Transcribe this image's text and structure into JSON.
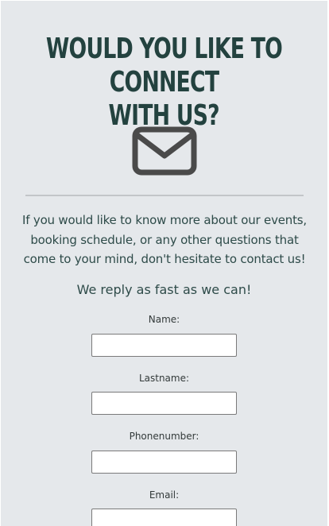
{
  "heading": {
    "line1": "WOULD YOU LIKE TO CONNECT",
    "line2": "WITH US?"
  },
  "icon": "envelope-icon",
  "intro_text": "If you would like to know more about our events, booking schedule, or any other questions that come to your mind, don't hesitate to contact us!",
  "reply_text": "We reply as fast as we can!",
  "form": {
    "fields": [
      {
        "label": "Name:",
        "value": ""
      },
      {
        "label": "Lastname:",
        "value": ""
      },
      {
        "label": "Phonenumber:",
        "value": ""
      },
      {
        "label": "Email:",
        "value": ""
      }
    ]
  },
  "colors": {
    "background": "#e5e8eb",
    "heading": "#23423f",
    "text": "#2e4b49",
    "icon": "#4a4a4a",
    "divider": "#c2c5c8"
  }
}
